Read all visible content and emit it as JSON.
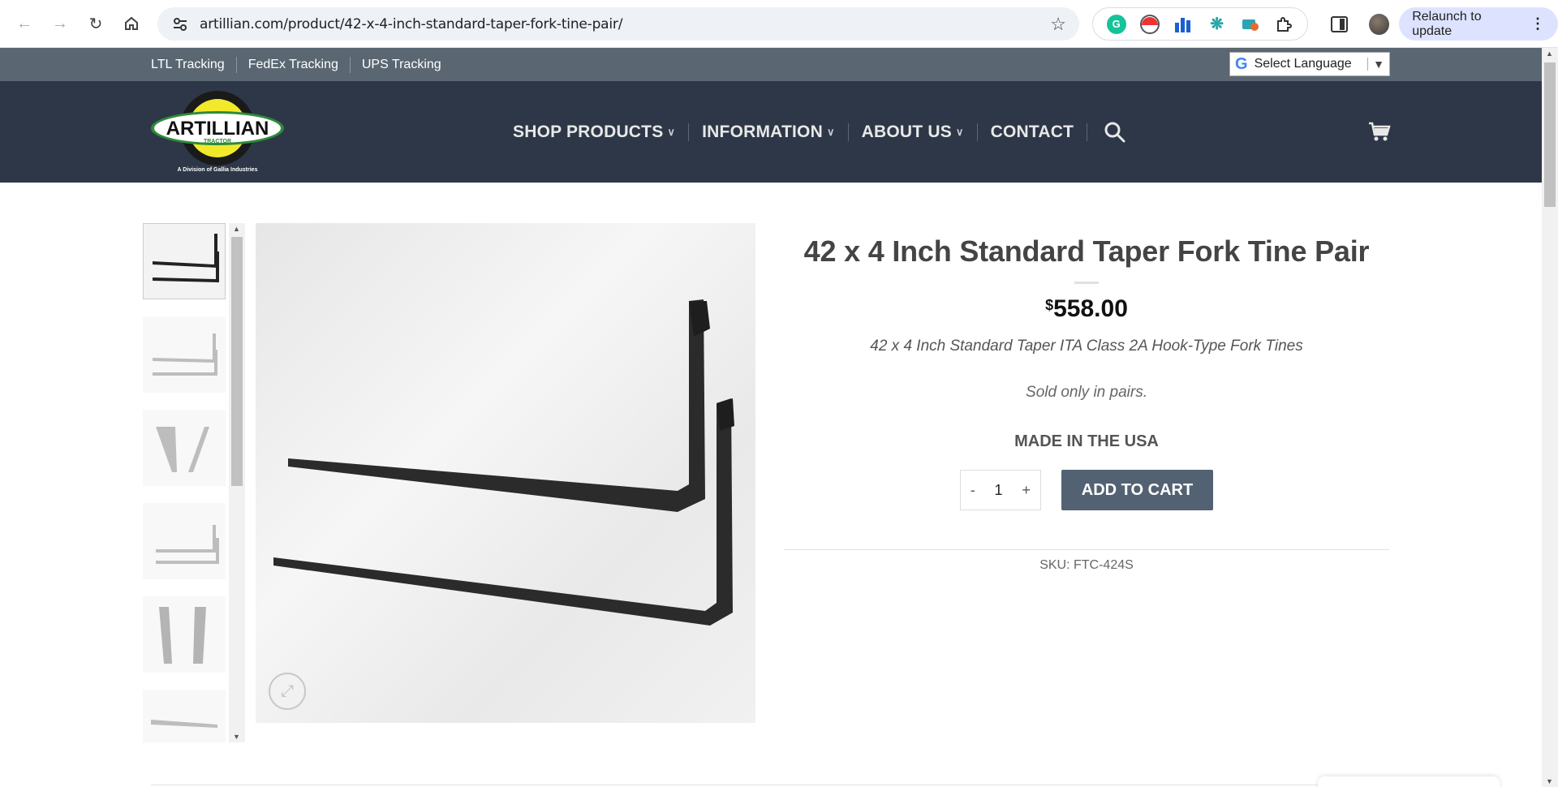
{
  "browser": {
    "url": "artillian.com/product/42-x-4-inch-standard-taper-fork-tine-pair/",
    "relaunch_label": "Relaunch to update",
    "extensions": [
      "grammarly-icon",
      "pokeball-icon",
      "chart-icon",
      "openai-icon",
      "cloud-icon",
      "puzzle-icon"
    ]
  },
  "topbar": {
    "links": [
      "LTL Tracking",
      "FedEx Tracking",
      "UPS Tracking"
    ],
    "language_label": "Select Language"
  },
  "header": {
    "logo_text": "ARTILLIAN",
    "logo_sub": "TRACTOR",
    "logo_tagline": "A Division of Gallia Industries",
    "nav": [
      {
        "label": "SHOP PRODUCTS",
        "has_dropdown": true
      },
      {
        "label": "INFORMATION",
        "has_dropdown": true
      },
      {
        "label": "ABOUT US",
        "has_dropdown": true
      },
      {
        "label": "CONTACT",
        "has_dropdown": false
      }
    ]
  },
  "product": {
    "title": "42 x 4 Inch Standard Taper Fork Tine Pair",
    "currency": "$",
    "price": "558.00",
    "subtitle": "42 x 4 Inch Standard Taper ITA Class 2A Hook-Type Fork Tines",
    "sold_note": "Sold only in pairs.",
    "made_in": "MADE IN THE USA",
    "qty_minus": "-",
    "qty_value": "1",
    "qty_plus": "+",
    "add_to_cart_label": "ADD TO CART",
    "sku": "SKU: FTC-424S",
    "thumbnail_count": 6
  },
  "colors": {
    "topbar": "#5a6772",
    "header": "#2d3748",
    "button": "#536272"
  }
}
